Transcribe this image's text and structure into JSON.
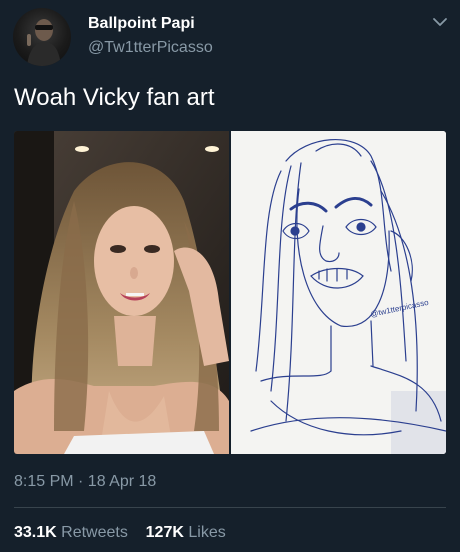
{
  "user": {
    "display_name": "Ballpoint Papi",
    "handle": "@Tw1tterPicasso"
  },
  "tweet": {
    "text": "Woah Vicky fan art",
    "timestamp": "8:15 PM · 18 Apr 18"
  },
  "media": {
    "left_image": "selfie-photo",
    "right_image": "pen-sketch",
    "sketch_signature": "@tw1tterpicasso"
  },
  "stats": {
    "retweets_count": "33.1K",
    "retweets_label": "Retweets",
    "likes_count": "127K",
    "likes_label": "Likes"
  },
  "colors": {
    "background": "#15202b",
    "secondary_text": "#8899a6",
    "divider": "#38444d",
    "sketch_ink": "#2b3f8f"
  }
}
